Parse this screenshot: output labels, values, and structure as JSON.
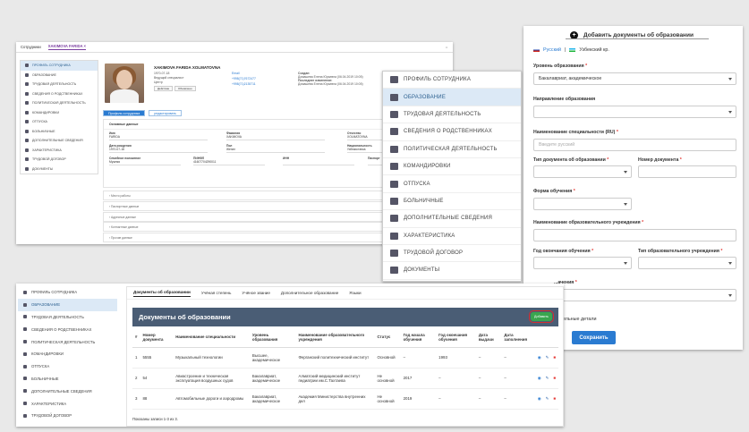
{
  "panel_a": {
    "tabbar": {
      "tab1": "Сотрудники",
      "tab2": "XAKIMOVA FARIDA ×",
      "more": "⇔"
    },
    "sidebar": [
      "ПРОФИЛЬ СОТРУДНИКА",
      "ОБРАЗОВАНИЕ",
      "ТРУДОВАЯ ДЕЯТЕЛЬНОСТЬ",
      "СВЕДЕНИЯ О РОДСТВЕННИКАХ",
      "ПОЛИТИЧЕСКАЯ ДЕЯТЕЛЬНОСТЬ",
      "КОМАНДИРОВКИ",
      "ОТПУСКА",
      "БОЛЬНИЧНЫЕ",
      "ДОПОЛНИТЕЛЬНЫЕ СВЕДЕНИЯ",
      "ХАРАКТЕРИСТИКА",
      "ТРУДОВОЙ ДОГОВОР",
      "ДОКУМЕНТЫ"
    ],
    "profile": {
      "name": "XAKIMOVA FARIDA XOLMATOVNA",
      "date": "1970-07-18",
      "role": "Ведущий специалист",
      "dept": "Центр",
      "btn1": "Действие",
      "btn2": "Обновлено",
      "email_label": "Email",
      "phone1": "+998(71)7672477",
      "phone2": "+998(71)2135711",
      "created_label": "Создан:",
      "created_by": "Домашева Елена Юрьевна (06.04.2019 10:05)",
      "updated_label": "Последнее изменение:",
      "updated_by": "Домашева Елена Юрьевна (06.04.2019 10:05)"
    },
    "tabs": {
      "profile": "Профиль сотрудника",
      "edit": "редактировать"
    },
    "card": {
      "title": "Основные данные",
      "labels": {
        "name": "Имя",
        "surname": "Фамилия",
        "patronymic": "Отчество",
        "birth": "Дата рождения",
        "gender": "Пол",
        "nationality": "Национальность",
        "family": "Семейное положение",
        "pinfl": "ПИНФЛ",
        "inn": "ИНН",
        "passport": "Паспорт"
      },
      "values": {
        "name": "FARIDA",
        "surname": "XAKIMOVA",
        "patronymic": "XOLMATOVNA",
        "birth": "1970-07-18",
        "gender": "Женат",
        "nationality": "Узбекистанка",
        "family": "Мужняя",
        "pinfl": "41607704290011"
      }
    },
    "accordions": [
      "Место работы",
      "Паспортные данные",
      "Адресные данные",
      "Контактные данные",
      "Прочие данные"
    ]
  },
  "panel_b": {
    "items": [
      "ПРОФИЛЬ СОТРУДНИКА",
      "ОБРАЗОВАНИЕ",
      "ТРУДОВАЯ ДЕЯТЕЛЬНОСТЬ",
      "СВЕДЕНИЯ О РОДСТВЕННИКАХ",
      "ПОЛИТИЧЕСКАЯ ДЕЯТЕЛЬНОСТЬ",
      "КОМАНДИРОВКИ",
      "ОТПУСКА",
      "БОЛЬНИЧНЫЕ",
      "ДОПОЛНИТЕЛЬНЫЕ СВЕДЕНИЯ",
      "ХАРАКТЕРИСТИКА",
      "ТРУДОВОЙ ДОГОВОР",
      "ДОКУМЕНТЫ"
    ]
  },
  "panel_c": {
    "title": "Добавить документы об образовании",
    "lang_ru": "Русский",
    "lang_sep": "|",
    "lang_uz": "Узбекский кр.",
    "edu_level_label": "Уровень образования",
    "edu_level_value": "Бакалавриат, академическое",
    "direction_label": "Направление образования",
    "specialty_label": "Наименование специальности (RU)",
    "specialty_placeholder": "Введите русский",
    "doc_type_label": "Тип документа об образовании",
    "doc_number_label": "Номер документа",
    "study_form_label": "Форма обучения",
    "institution_label": "Наименование образовательного учреждения",
    "grad_year_label": "Год окончания обучения",
    "institution_type_label": "Тип образовательного учреждения",
    "partial_label": "...ачения",
    "partial_details": "...ительные детали",
    "save": "Сохранить",
    "req": "*"
  },
  "panel_d": {
    "sidebar": [
      "ПРОФИЛЬ СОТРУДНИКА",
      "ОБРАЗОВАНИЕ",
      "ТРУДОВАЯ ДЕЯТЕЛЬНОСТЬ",
      "СВЕДЕНИЯ О РОДСТВЕННИКАХ",
      "ПОЛИТИЧЕСКАЯ ДЕЯТЕЛЬНОСТЬ",
      "КОМАНДИРОВКИ",
      "ОТПУСКА",
      "БОЛЬНИЧНЫЕ",
      "ДОПОЛНИТЕЛЬНЫЕ СВЕДЕНИЯ",
      "ХАРАКТЕРИСТИКА",
      "ТРУДОВОЙ ДОГОВОР"
    ],
    "tabs": [
      "Документы об образовании",
      "Учёная степень",
      "Учёное звание",
      "Дополнительное образование",
      "Языки"
    ],
    "header": "Документы об образовании",
    "add": "Добавить",
    "columns": [
      "#",
      "Номер документа",
      "Наименование специальности",
      "Уровень образования",
      "Наименование образовательного учреждения",
      "Статус",
      "Год начала обучения",
      "Год окончания обучения",
      "Дата выдачи",
      "Дата заполнения"
    ],
    "rows": [
      [
        "1",
        "5555",
        "Музыкальный технологии",
        "Высшее, академическое",
        "Ферганский политехнический институт",
        "Основной",
        "–",
        "1993",
        "–",
        "–"
      ],
      [
        "2",
        "54",
        "Авиастроение и техническая эксплуатация воздушных судов",
        "Бакалавриат, академическое",
        "Алматский медицинский институт педиатрии им.С.Тахтаева",
        "Не основной",
        "2017",
        "–",
        "–",
        "–"
      ],
      [
        "3",
        "88",
        "Автомобильные дороги и аэродромы",
        "Бакалавриат, академическое",
        "Академия Министерства внутренних дел",
        "Не основной",
        "2019",
        "–",
        "–",
        "–"
      ]
    ],
    "footer": "Показаны записи 1-3 из 3."
  }
}
